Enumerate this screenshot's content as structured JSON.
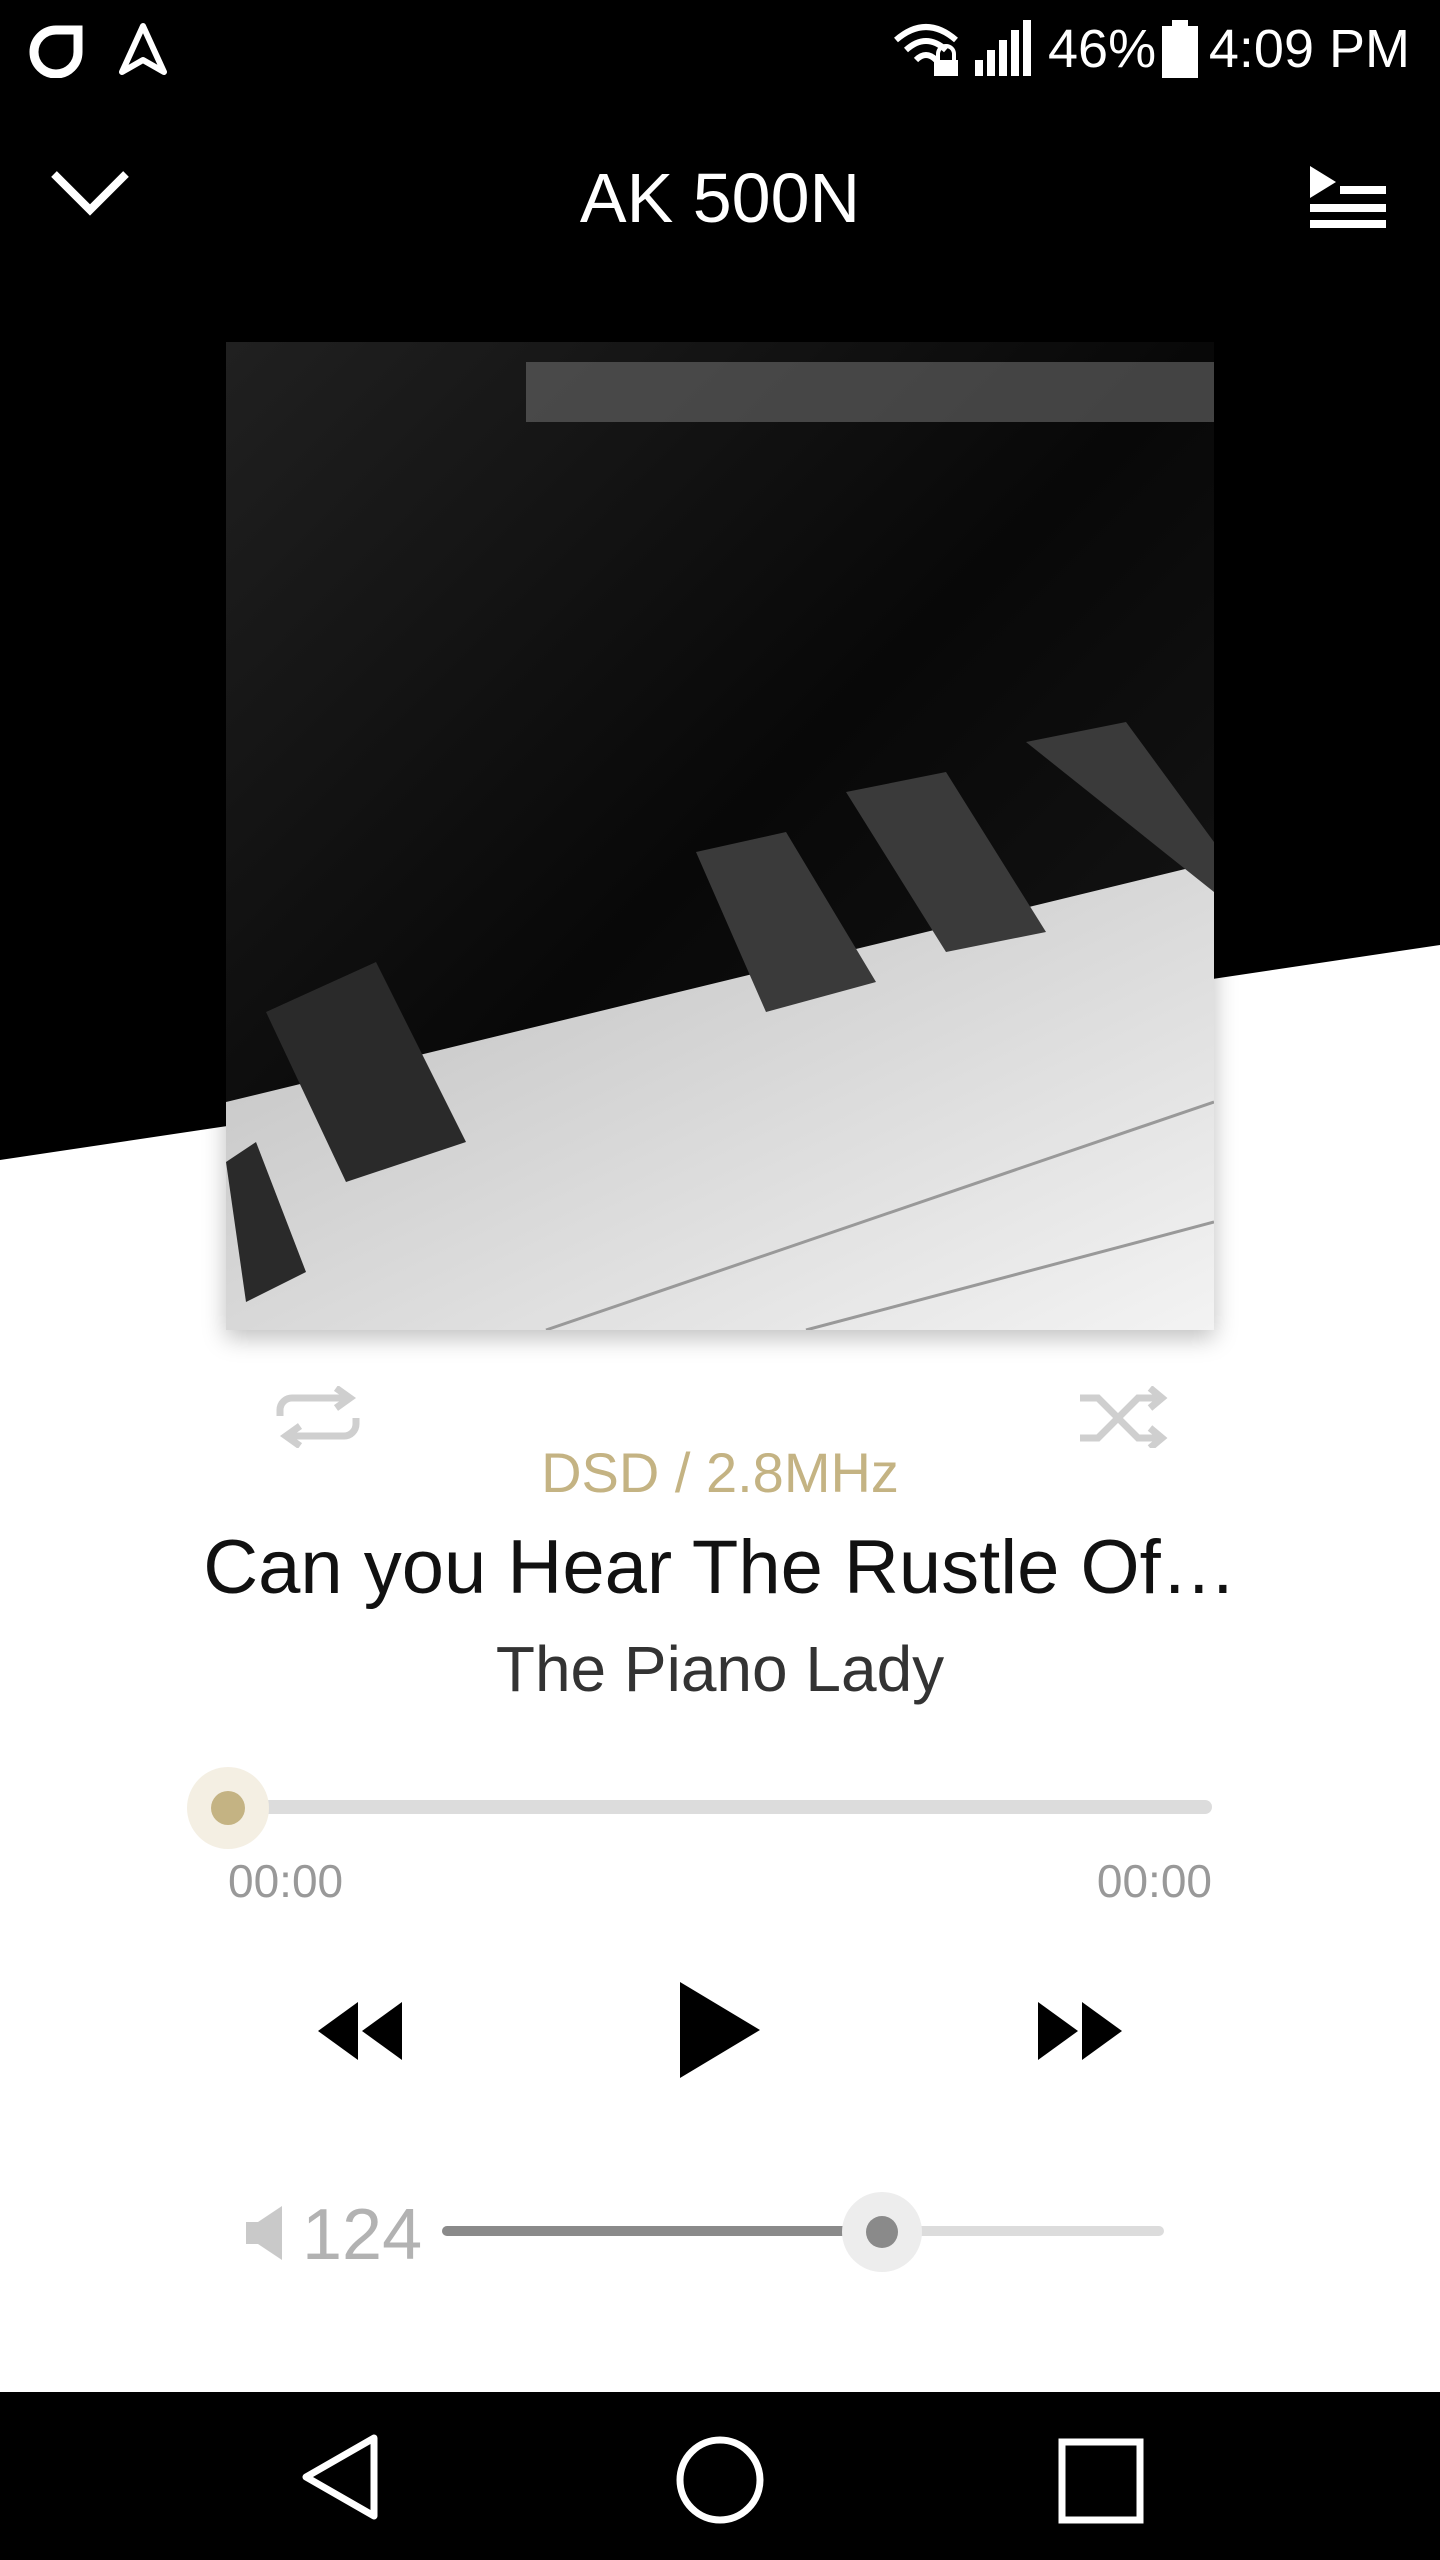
{
  "status_bar": {
    "battery": "46%",
    "time": "4:09 PM",
    "icons": [
      "ring-icon",
      "navigation-arrow-icon",
      "wifi-lock-icon",
      "signal-icon",
      "battery-icon"
    ]
  },
  "header": {
    "title": "AK 500N",
    "left_icon": "chevron-down-icon",
    "right_icon": "now-playing-list-icon"
  },
  "album_art": {
    "description_icon": "piano-keys-artwork"
  },
  "controls_top": {
    "repeat_icon": "repeat-icon",
    "shuffle_icon": "shuffle-icon"
  },
  "track": {
    "format": "DSD / 2.8MHz",
    "title": "Can you Hear The Rustle Of…",
    "artist": "The Piano Lady"
  },
  "progress": {
    "elapsed": "00:00",
    "total": "00:00",
    "fraction": 0.0
  },
  "playback": {
    "prev_icon": "rewind-icon",
    "play_icon": "play-icon",
    "next_icon": "fast-forward-icon"
  },
  "volume": {
    "value": "124",
    "fraction": 0.61,
    "icon": "speaker-icon"
  },
  "nav_bar": {
    "icons": [
      "back-icon",
      "home-icon",
      "recents-icon"
    ]
  },
  "colors": {
    "accent": "#c4b383",
    "background": "#000000",
    "surface": "#ffffff"
  }
}
